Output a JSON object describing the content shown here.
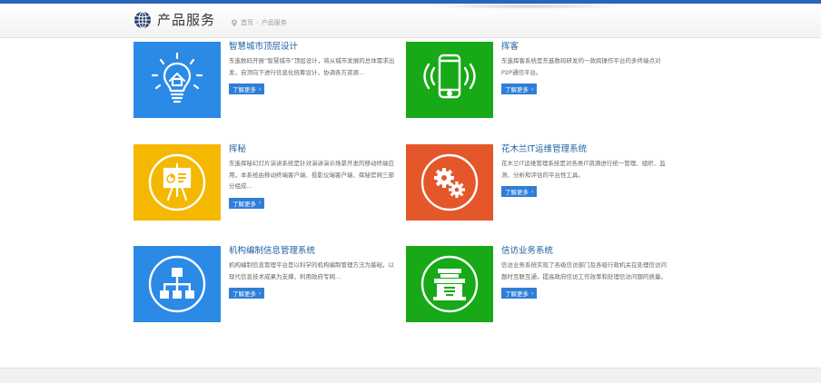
{
  "header": {
    "title": "产品服务",
    "breadcrumb": {
      "home": "首页",
      "separator": "›",
      "current": "产品服务"
    },
    "icon": "globe-icon",
    "accent_color": "#2b64b8"
  },
  "products": [
    {
      "title": "智慧城市顶层设计",
      "desc": "东進数码开展“智慧城市”顶层设计，将从城市发展的总体需求出发，自顶向下进行信息化统筹设计，协调各方资源...",
      "more": "了解更多",
      "icon": "lightbulb-icon",
      "color": "#2a8ae6"
    },
    {
      "title": "挥客",
      "desc": "东進挥客系统是东進数码研发的一款跨操作平台的多终端点对P2P通信平台。",
      "more": "了解更多",
      "icon": "mobile-phone-icon",
      "color": "#17a917"
    },
    {
      "title": "挥秘",
      "desc": "东進挥秘幻灯片演讲系统是针对演讲演示场景开发的移动终端应用，本系统由移动终端客户端、投影仪端客户端、挥秘官网三部分组成...",
      "more": "了解更多",
      "icon": "presentation-board-icon",
      "color": "#f5b800"
    },
    {
      "title": "花木兰IT运维管理系统",
      "desc": "花木兰IT运维管理系统是对各类IT资源进行统一管理、组织、监测、分析和评估的平台性工具。",
      "more": "了解更多",
      "icon": "gears-icon",
      "color": "#e4572b"
    },
    {
      "title": "机构编制信息管理系统",
      "desc": "机构编制信息管理平台是以科学的机构编制管理方法为基础，以现代信息技术成果为支撑，利用政府专网...",
      "more": "了解更多",
      "icon": "org-chart-icon",
      "color": "#2a8ae6"
    },
    {
      "title": "信访业务系统",
      "desc": "信访业务系统实现了各级信访部门及各级行政机关在处理信访问题时互联互通，提高政府信访工作效率和处理信访问题的质量。",
      "more": "了解更多",
      "icon": "document-tray-icon",
      "color": "#17a917"
    }
  ]
}
